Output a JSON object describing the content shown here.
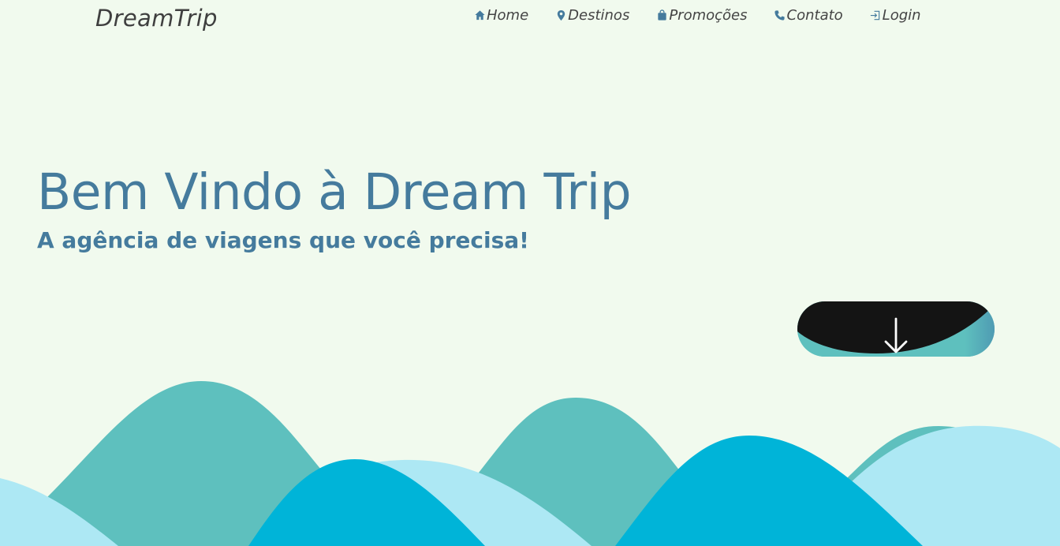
{
  "header": {
    "logo": "DreamTrip",
    "nav": [
      {
        "label": "Home",
        "icon": "home-icon"
      },
      {
        "label": "Destinos",
        "icon": "map-pin-icon"
      },
      {
        "label": "Promoções",
        "icon": "shopping-bag-icon"
      },
      {
        "label": "Contato",
        "icon": "phone-icon"
      },
      {
        "label": "Login",
        "icon": "login-icon"
      }
    ]
  },
  "hero": {
    "title": "Bem Vindo à Dream Trip",
    "subtitle": "A agência de viagens que você precisa!"
  },
  "scroll_button": {
    "icon": "arrow-down-icon"
  },
  "colors": {
    "background": "#f1faee",
    "primary": "#457b9d",
    "teal": "#5ec0be",
    "cyan": "#00b4d8",
    "light_blue": "#ade8f4",
    "dark": "#141414"
  }
}
